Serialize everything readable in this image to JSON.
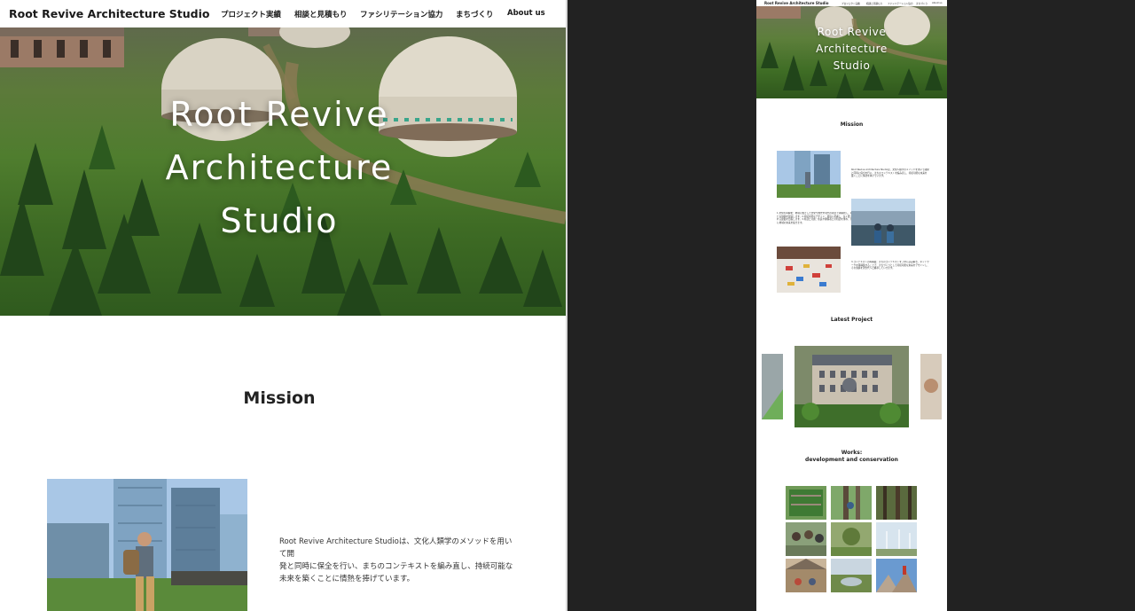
{
  "desktop": {
    "header": {
      "logo": "Root Revive Architecture Studio",
      "nav": [
        "プロジェクト実績",
        "相談と見積もり",
        "ファシリテーション協力",
        "まちづくり",
        "About us"
      ]
    },
    "hero": {
      "title_lines": [
        "Root Revive",
        "Architecture",
        "Studio"
      ]
    },
    "mission": {
      "heading": "Mission",
      "text_lines": [
        "Root Revive Architecture Studioは、文化人類学のメソッドを用いて開",
        "発と同時に保全を行い、まちのコンテキストを編み直し、持続可能な",
        "未来を築くことに情熱を捧げています。"
      ]
    }
  },
  "mobile": {
    "header": {
      "logo": "Root Revive Architecture Studio",
      "nav": [
        "プロジェクト実績",
        "相談と見積もり",
        "ファシリテーション協力",
        "まちづくり",
        "About us"
      ]
    },
    "hero": {
      "title_lines": [
        "Root Revive",
        "Architecture",
        "Studio"
      ]
    },
    "mission_heading": "Mission",
    "mission_text_1": "Root Revive Architecture Studioは、文化人類学のメソッドを用いて開発と同時に保全を行い、まちのコンテキストを編み直し、持続可能な未来を築くことに情熱を捧げています。",
    "mission_text_2": "1.文化の再解釈：地域に根ざした文化や歴史を現代の視点で再解釈し、新たな価値を創造します。2.持続可能なデザイン：環境に配慮し、長く愛される建築を目指します。3.対話と共創：住民や関係者との対話を重ね、共に地域の未来を描きます。",
    "mission_text_3": "3.コンテキストの再構築：まちのコンテキストを丁寧に読み解き、ネットワークを再構築することで、まちづくりとして持続可能な未来をデザインし、その価値を次世代へと継承していきます。",
    "latest_heading": "Latest Project",
    "works_heading_lines": [
      "Works:",
      "development and conservation"
    ]
  },
  "colors": {
    "text": "#1a1a1a",
    "divider": "#d8d8d8",
    "background_dark": "#222222",
    "hero_green": "#4f7d2e"
  }
}
